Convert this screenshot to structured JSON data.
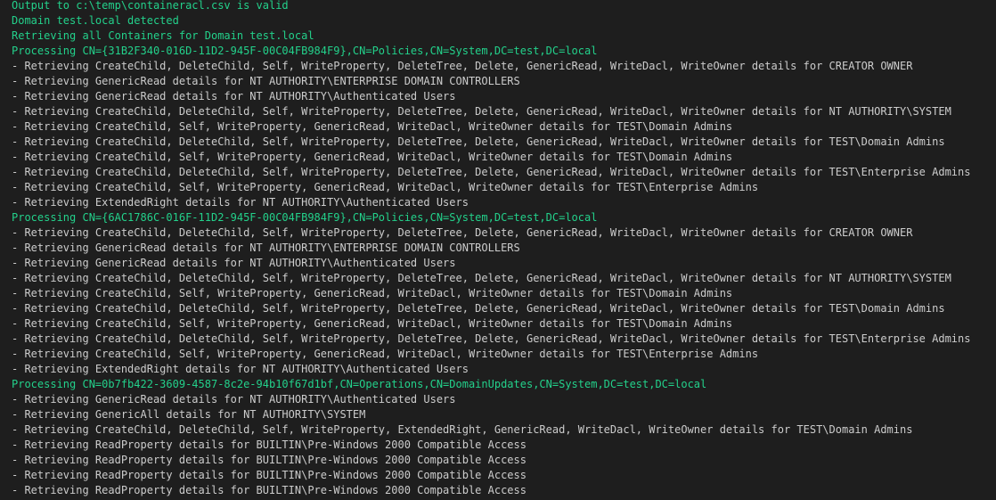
{
  "colors": {
    "background": "#1e1e1e",
    "green": "#23d18b",
    "white": "#cccccc"
  },
  "terminal": {
    "lines": [
      {
        "text": "Output to c:\\temp\\containeracl.csv is valid",
        "color": "green"
      },
      {
        "text": "Domain test.local detected",
        "color": "green"
      },
      {
        "text": "Retrieving all Containers for Domain test.local",
        "color": "green"
      },
      {
        "text": "Processing CN={31B2F340-016D-11D2-945F-00C04FB984F9},CN=Policies,CN=System,DC=test,DC=local",
        "color": "green"
      },
      {
        "text": "- Retrieving CreateChild, DeleteChild, Self, WriteProperty, DeleteTree, Delete, GenericRead, WriteDacl, WriteOwner details for CREATOR OWNER",
        "color": "white"
      },
      {
        "text": "- Retrieving GenericRead details for NT AUTHORITY\\ENTERPRISE DOMAIN CONTROLLERS",
        "color": "white"
      },
      {
        "text": "- Retrieving GenericRead details for NT AUTHORITY\\Authenticated Users",
        "color": "white"
      },
      {
        "text": "- Retrieving CreateChild, DeleteChild, Self, WriteProperty, DeleteTree, Delete, GenericRead, WriteDacl, WriteOwner details for NT AUTHORITY\\SYSTEM",
        "color": "white"
      },
      {
        "text": "- Retrieving CreateChild, Self, WriteProperty, GenericRead, WriteDacl, WriteOwner details for TEST\\Domain Admins",
        "color": "white"
      },
      {
        "text": "- Retrieving CreateChild, DeleteChild, Self, WriteProperty, DeleteTree, Delete, GenericRead, WriteDacl, WriteOwner details for TEST\\Domain Admins",
        "color": "white"
      },
      {
        "text": "- Retrieving CreateChild, Self, WriteProperty, GenericRead, WriteDacl, WriteOwner details for TEST\\Domain Admins",
        "color": "white"
      },
      {
        "text": "- Retrieving CreateChild, DeleteChild, Self, WriteProperty, DeleteTree, Delete, GenericRead, WriteDacl, WriteOwner details for TEST\\Enterprise Admins",
        "color": "white"
      },
      {
        "text": "- Retrieving CreateChild, Self, WriteProperty, GenericRead, WriteDacl, WriteOwner details for TEST\\Enterprise Admins",
        "color": "white"
      },
      {
        "text": "- Retrieving ExtendedRight details for NT AUTHORITY\\Authenticated Users",
        "color": "white"
      },
      {
        "text": "Processing CN={6AC1786C-016F-11D2-945F-00C04FB984F9},CN=Policies,CN=System,DC=test,DC=local",
        "color": "green"
      },
      {
        "text": "- Retrieving CreateChild, DeleteChild, Self, WriteProperty, DeleteTree, Delete, GenericRead, WriteDacl, WriteOwner details for CREATOR OWNER",
        "color": "white"
      },
      {
        "text": "- Retrieving GenericRead details for NT AUTHORITY\\ENTERPRISE DOMAIN CONTROLLERS",
        "color": "white"
      },
      {
        "text": "- Retrieving GenericRead details for NT AUTHORITY\\Authenticated Users",
        "color": "white"
      },
      {
        "text": "- Retrieving CreateChild, DeleteChild, Self, WriteProperty, DeleteTree, Delete, GenericRead, WriteDacl, WriteOwner details for NT AUTHORITY\\SYSTEM",
        "color": "white"
      },
      {
        "text": "- Retrieving CreateChild, Self, WriteProperty, GenericRead, WriteDacl, WriteOwner details for TEST\\Domain Admins",
        "color": "white"
      },
      {
        "text": "- Retrieving CreateChild, DeleteChild, Self, WriteProperty, DeleteTree, Delete, GenericRead, WriteDacl, WriteOwner details for TEST\\Domain Admins",
        "color": "white"
      },
      {
        "text": "- Retrieving CreateChild, Self, WriteProperty, GenericRead, WriteDacl, WriteOwner details for TEST\\Domain Admins",
        "color": "white"
      },
      {
        "text": "- Retrieving CreateChild, DeleteChild, Self, WriteProperty, DeleteTree, Delete, GenericRead, WriteDacl, WriteOwner details for TEST\\Enterprise Admins",
        "color": "white"
      },
      {
        "text": "- Retrieving CreateChild, Self, WriteProperty, GenericRead, WriteDacl, WriteOwner details for TEST\\Enterprise Admins",
        "color": "white"
      },
      {
        "text": "- Retrieving ExtendedRight details for NT AUTHORITY\\Authenticated Users",
        "color": "white"
      },
      {
        "text": "Processing CN=0b7fb422-3609-4587-8c2e-94b10f67d1bf,CN=Operations,CN=DomainUpdates,CN=System,DC=test,DC=local",
        "color": "green"
      },
      {
        "text": "- Retrieving GenericRead details for NT AUTHORITY\\Authenticated Users",
        "color": "white"
      },
      {
        "text": "- Retrieving GenericAll details for NT AUTHORITY\\SYSTEM",
        "color": "white"
      },
      {
        "text": "- Retrieving CreateChild, DeleteChild, Self, WriteProperty, ExtendedRight, GenericRead, WriteDacl, WriteOwner details for TEST\\Domain Admins",
        "color": "white"
      },
      {
        "text": "- Retrieving ReadProperty details for BUILTIN\\Pre-Windows 2000 Compatible Access",
        "color": "white"
      },
      {
        "text": "- Retrieving ReadProperty details for BUILTIN\\Pre-Windows 2000 Compatible Access",
        "color": "white"
      },
      {
        "text": "- Retrieving ReadProperty details for BUILTIN\\Pre-Windows 2000 Compatible Access",
        "color": "white"
      },
      {
        "text": "- Retrieving ReadProperty details for BUILTIN\\Pre-Windows 2000 Compatible Access",
        "color": "white"
      }
    ]
  }
}
